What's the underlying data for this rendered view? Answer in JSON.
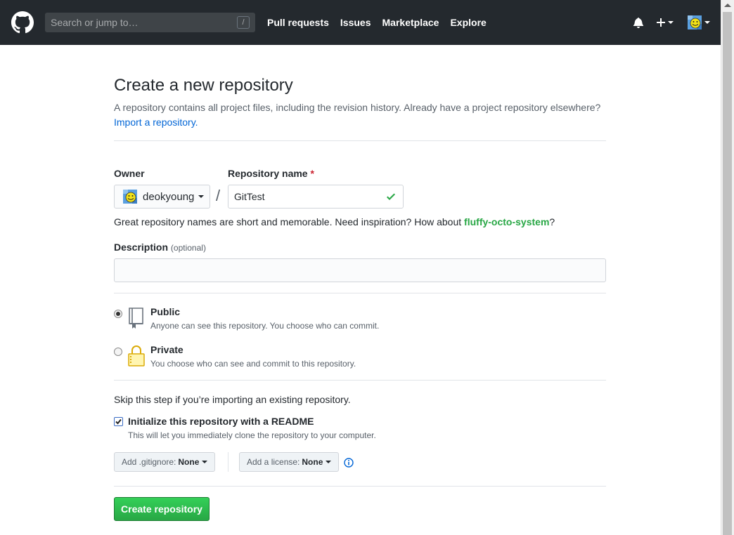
{
  "header": {
    "search_placeholder": "Search or jump to…",
    "search_shortcut": "/",
    "nav": [
      "Pull requests",
      "Issues",
      "Marketplace",
      "Explore"
    ]
  },
  "page": {
    "title": "Create a new repository",
    "subtitle": "A repository contains all project files, including the revision history. Already have a project repository elsewhere?",
    "import_link": "Import a repository."
  },
  "form": {
    "owner_label": "Owner",
    "owner_name": "deokyoung",
    "slash": "/",
    "repo_label": "Repository name",
    "required_mark": "*",
    "repo_value": "GitTest",
    "hint_prefix": "Great repository names are short and memorable. Need inspiration? How about",
    "hint_suggestion": "fluffy-octo-system",
    "hint_suffix": "?",
    "description_label": "Description",
    "description_optional": "(optional)",
    "description_value": "",
    "visibility": {
      "public_title": "Public",
      "public_desc": "Anyone can see this repository. You choose who can commit.",
      "private_title": "Private",
      "private_desc": "You choose who can see and commit to this repository."
    },
    "skip_note": "Skip this step if you’re importing an existing repository.",
    "init_label": "Initialize this repository with a README",
    "init_note": "This will let you immediately clone the repository to your computer.",
    "gitignore_label": "Add .gitignore:",
    "gitignore_value": "None",
    "license_label": "Add a license:",
    "license_value": "None",
    "create_button": "Create repository"
  },
  "colors": {
    "header_bg": "#24292e",
    "link": "#0366d6",
    "success": "#28a745"
  }
}
